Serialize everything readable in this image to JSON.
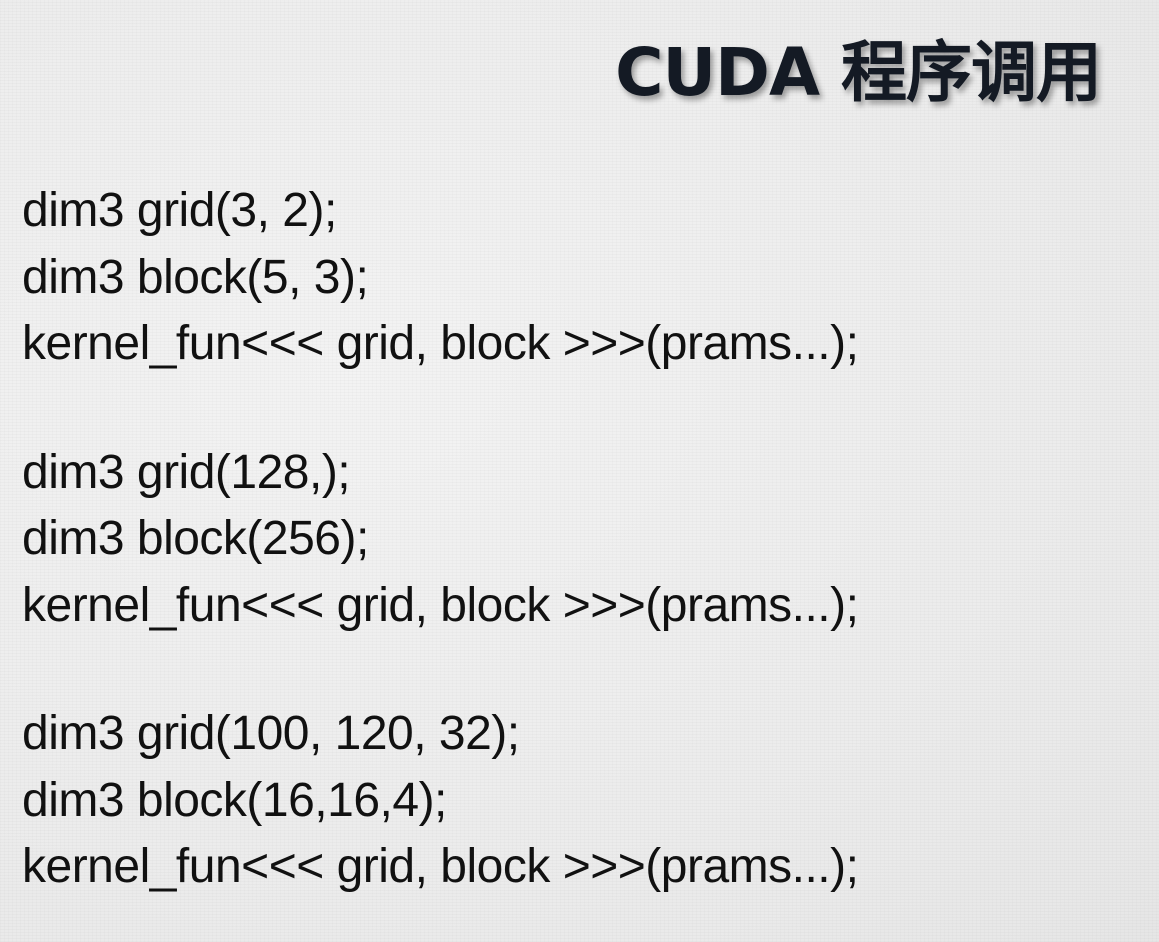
{
  "slide": {
    "title": "CUDA 程序调用"
  },
  "code_groups": [
    {
      "lines": [
        "dim3 grid(3, 2);",
        "dim3 block(5, 3);",
        "kernel_fun<<< grid, block >>>(prams...);"
      ]
    },
    {
      "lines": [
        "dim3 grid(128,);",
        "dim3 block(256);",
        "kernel_fun<<< grid, block >>>(prams...);"
      ]
    },
    {
      "lines": [
        "dim3 grid(100, 120, 32);",
        "dim3 block(16,16,4);",
        "kernel_fun<<< grid, block >>>(prams...);"
      ]
    }
  ]
}
